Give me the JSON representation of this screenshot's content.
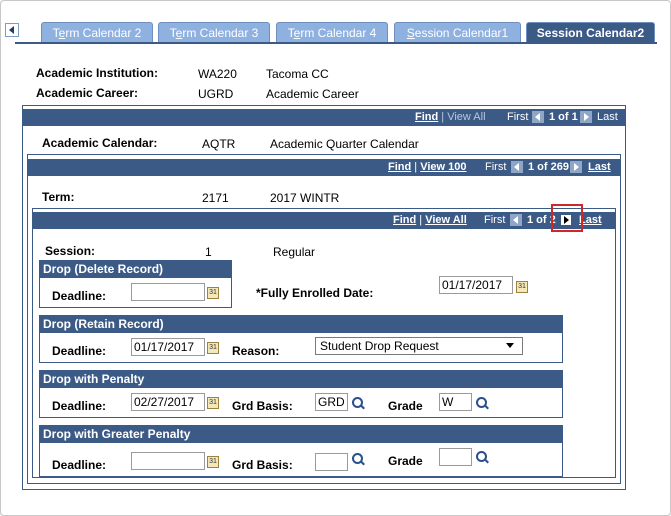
{
  "tabs": [
    {
      "label": "Term Calendar 2",
      "accel": "e"
    },
    {
      "label": "Term Calendar 3",
      "accel": "e"
    },
    {
      "label": "Term Calendar 4",
      "accel": "e"
    },
    {
      "label": "Session Calendar1",
      "accel": "S"
    },
    {
      "label": "Session Calendar2",
      "accel": ""
    }
  ],
  "header": {
    "institution_label": "Academic Institution:",
    "institution_code": "WA220",
    "institution_name": "Tacoma CC",
    "career_label": "Academic Career:",
    "career_code": "UGRD",
    "career_name": "Academic Career"
  },
  "outer_nav": {
    "find": "Find",
    "sep": "|",
    "view": "View All",
    "first": "First",
    "count": "1 of 1",
    "last": "Last"
  },
  "calendar": {
    "label": "Academic Calendar:",
    "code": "AQTR",
    "name": "Academic Quarter Calendar",
    "nav": {
      "find": "Find",
      "sep": "|",
      "view": "View 100",
      "first": "First",
      "count": "1 of 269",
      "last": "Last"
    }
  },
  "term": {
    "label": "Term:",
    "code": "2171",
    "name": "2017 WINTR",
    "nav": {
      "find": "Find",
      "sep": "|",
      "view": "View All",
      "first": "First",
      "count": "1 of 2",
      "last": "Last"
    }
  },
  "session": {
    "label": "Session:",
    "code": "1",
    "name": "Regular",
    "fully_enrolled_label": "*Fully Enrolled Date:",
    "fully_enrolled_value": "01/17/2017"
  },
  "drop_delete": {
    "title": "Drop (Delete Record)",
    "deadline_label": "Deadline:",
    "deadline_value": ""
  },
  "drop_retain": {
    "title": "Drop (Retain Record)",
    "deadline_label": "Deadline:",
    "deadline_value": "01/17/2017",
    "reason_label": "Reason:",
    "reason_value": "Student Drop Request"
  },
  "drop_penalty": {
    "title": "Drop with Penalty",
    "deadline_label": "Deadline:",
    "deadline_value": "02/27/2017",
    "grd_basis_label": "Grd Basis:",
    "grd_basis_value": "GRD",
    "grade_label": "Grade",
    "grade_value": "W"
  },
  "drop_greater": {
    "title": "Drop with Greater Penalty",
    "deadline_label": "Deadline:",
    "deadline_value": "",
    "grd_basis_label": "Grd Basis:",
    "grd_basis_value": "",
    "grade_label": "Grade",
    "grade_value": ""
  },
  "icons": {
    "calendar": "31"
  },
  "colors": {
    "header_blue": "#3c5a86",
    "tab_inactive": "#8fb1df",
    "highlight_red": "#d32626"
  }
}
